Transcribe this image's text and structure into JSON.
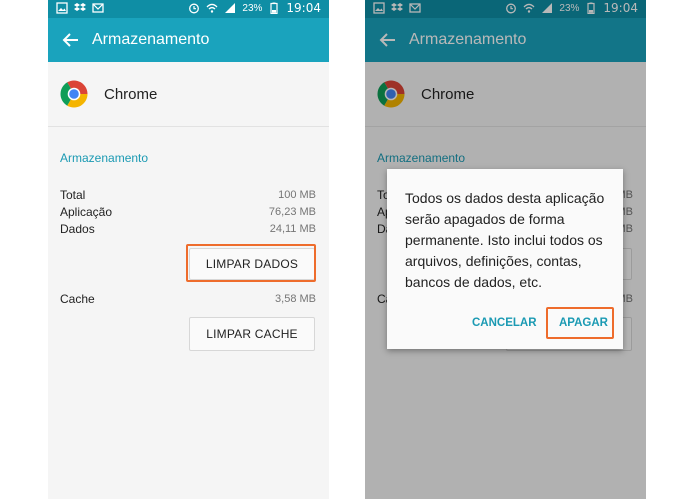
{
  "status_bar": {
    "time": "19:04",
    "battery": "23%"
  },
  "screen_left": {
    "app_bar": {
      "title": "Armazenamento"
    },
    "app": {
      "name": "Chrome"
    },
    "section_title": "Armazenamento",
    "rows": [
      {
        "label": "Total",
        "value": "100 MB"
      },
      {
        "label": "Aplicação",
        "value": "76,23 MB"
      },
      {
        "label": "Dados",
        "value": "24,11 MB"
      }
    ],
    "clear_data_button": "LIMPAR DADOS",
    "cache": {
      "label": "Cache",
      "value": "3,58 MB"
    },
    "clear_cache_button": "LIMPAR CACHE"
  },
  "screen_right": {
    "app_bar": {
      "title": "Armazenamento"
    },
    "app": {
      "name": "Chrome"
    },
    "section_title": "Armazenamento",
    "dialog": {
      "message": "Todos os dados desta aplicação serão apagados de forma permanente. Isto inclui todos os arquivos, definições, contas, bancos de dados, etc.",
      "cancel_label": "CANCELAR",
      "confirm_label": "APAGAR"
    }
  },
  "colors": {
    "status_bar": "#0f8ea5",
    "app_bar": "#1aa3bd",
    "accent": "#1b9ab3",
    "highlight": "#ee6c2c"
  }
}
